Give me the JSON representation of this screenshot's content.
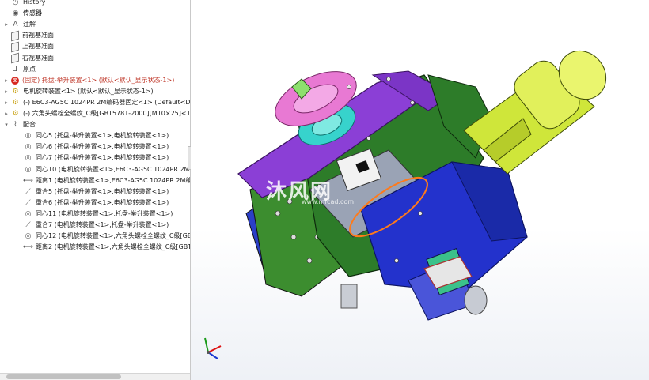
{
  "tree": {
    "items": [
      {
        "label": "History",
        "icon": "history-icon",
        "expander": "",
        "level": 1
      },
      {
        "label": "传感器",
        "icon": "sensor-icon",
        "expander": "",
        "level": 1
      },
      {
        "label": "注解",
        "icon": "annotation-icon",
        "expander": "▸",
        "level": 1
      },
      {
        "label": "前视基准面",
        "icon": "plane-icon",
        "expander": "",
        "level": 1
      },
      {
        "label": "上视基准面",
        "icon": "plane-icon",
        "expander": "",
        "level": 1
      },
      {
        "label": "右视基准面",
        "icon": "plane-icon",
        "expander": "",
        "level": 1
      },
      {
        "label": "原点",
        "icon": "origin-icon",
        "expander": "",
        "level": 1
      },
      {
        "label": "(固定) 托盘-举升装置<1> (默认<默认_显示状态-1>)",
        "icon": "part-error-icon",
        "expander": "▸",
        "level": 1
      },
      {
        "label": "电机旋转装置<1> (默认<默认_显示状态-1>)",
        "icon": "part-icon",
        "expander": "▸",
        "level": 1
      },
      {
        "label": "(-) E6C3-AG5C 1024PR 2M编码器固定<1> (Default<Defa",
        "icon": "part-icon",
        "expander": "▸",
        "level": 1
      },
      {
        "label": "(-) 六角头螺栓全螺纹_C级[GBT5781-2000][M10×25]<1> (",
        "icon": "part-icon",
        "expander": "▸",
        "level": 1
      },
      {
        "label": "配合",
        "icon": "mates-folder-icon",
        "expander": "▾",
        "level": 1
      },
      {
        "label": "同心5 (托盘-举升装置<1>,电机旋转装置<1>)",
        "icon": "concentric-icon",
        "expander": "",
        "level": 2
      },
      {
        "label": "同心6 (托盘-举升装置<1>,电机旋转装置<1>)",
        "icon": "concentric-icon",
        "expander": "",
        "level": 2
      },
      {
        "label": "同心7 (托盘-举升装置<1>,电机旋转装置<1>)",
        "icon": "concentric-icon",
        "expander": "",
        "level": 2
      },
      {
        "label": "同心10 (电机旋转装置<1>,E6C3-AG5C 1024PR 2M编码",
        "icon": "concentric-icon",
        "expander": "",
        "level": 2
      },
      {
        "label": "距离1 (电机旋转装置<1>,E6C3-AG5C 1024PR 2M编码",
        "icon": "distance-icon",
        "expander": "",
        "level": 2
      },
      {
        "label": "重合5 (托盘-举升装置<1>,电机旋转装置<1>)",
        "icon": "coincident-icon",
        "expander": "",
        "level": 2
      },
      {
        "label": "重合6 (托盘-举升装置<1>,电机旋转装置<1>)",
        "icon": "coincident-icon",
        "expander": "",
        "level": 2
      },
      {
        "label": "同心11 (电机旋转装置<1>,托盘-举升装置<1>)",
        "icon": "concentric-icon",
        "expander": "",
        "level": 2
      },
      {
        "label": "重合7 (电机旋转装置<1>,托盘-举升装置<1>)",
        "icon": "coincident-icon",
        "expander": "",
        "level": 2
      },
      {
        "label": "同心12 (电机旋转装置<1>,六角头螺栓全螺纹_C级[GBT5",
        "icon": "concentric-icon",
        "expander": "",
        "level": 2
      },
      {
        "label": "距离2 (电机旋转装置<1>,六角头螺栓全螺纹_C级[GBT57",
        "icon": "distance-icon",
        "expander": "",
        "level": 2
      }
    ]
  },
  "viewport": {
    "watermark": "沐风网",
    "watermark_url": "www.mfcad.com"
  },
  "colors": {
    "motor_green": "#d8ef3a",
    "gearbox_blue": "#2233cc",
    "frame_green": "#2f8a2a",
    "plate_purple": "#8a3fd0",
    "coupling_cyan": "#35d6cf",
    "disc_pink": "#e77ad2",
    "bracket_gray": "#9aa3b5"
  }
}
